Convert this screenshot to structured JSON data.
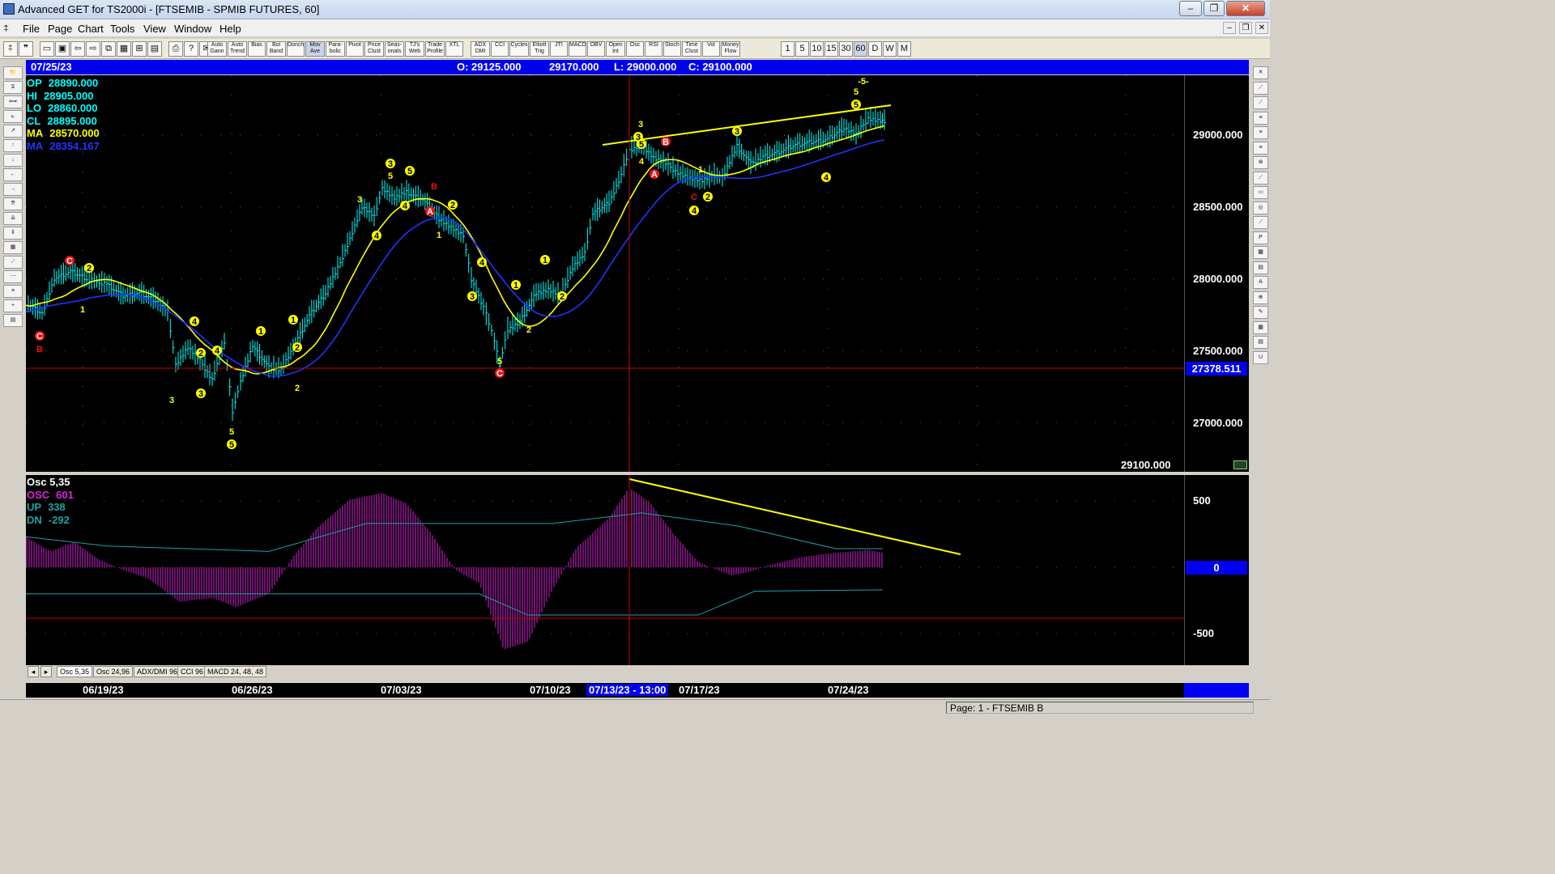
{
  "window": {
    "title": "Advanced GET for TS2000i - [FTSEMIB - SPMIB FUTURES, 60]",
    "min": "‒",
    "max": "❐",
    "close": "✕"
  },
  "menu": [
    "File",
    "Page",
    "Chart",
    "Tools",
    "View",
    "Window",
    "Help"
  ],
  "toolbar": {
    "study_buttons": [
      "Auto Gann",
      "Auto Trend",
      "Bias",
      "Bol Band",
      "Donch",
      "Mov Ave",
      "Para-bolic",
      "Pivot",
      "Price Clust",
      "Seas-onals",
      "TJ's Web",
      "Trade Profile",
      "XTL",
      "ADX DMI",
      "CCI",
      "Cycles",
      "Elliott Trig",
      "JTI",
      "MACD",
      "OBV",
      "Open Int",
      "Osc",
      "RSI",
      "Stoch",
      "Time Clust",
      "Vol",
      "Money Flow"
    ],
    "intervals": [
      "1",
      "5",
      "10",
      "15",
      "30",
      "60",
      "D",
      "W",
      "M"
    ],
    "selected_interval": "60"
  },
  "header_bar": {
    "date": "07/25/23",
    "open": "O: 29125.000",
    "high": "29170.000",
    "low": "L: 29000.000",
    "close": "C: 29100.000"
  },
  "legend": [
    {
      "label": "OP",
      "value": "28890.000",
      "color": "#00ffff"
    },
    {
      "label": "HI",
      "value": "28905.000",
      "color": "#00ffff"
    },
    {
      "label": "LO",
      "value": "28860.000",
      "color": "#00ffff"
    },
    {
      "label": "CL",
      "value": "28895.000",
      "color": "#00ffff"
    },
    {
      "label": "MA",
      "value": "28570.000",
      "color": "#ffff00"
    },
    {
      "label": "MA",
      "value": "28354.167",
      "color": "#2233ff"
    }
  ],
  "price_axis": [
    "29000.000",
    "28500.000",
    "28000.000",
    "27500.000",
    "27000.000"
  ],
  "cursor_price": "27378.511",
  "last_price_label": "29100.000",
  "osc_legend": [
    {
      "label": "Osc 5,35",
      "value": "",
      "color": "#ffffff"
    },
    {
      "label": "OSC",
      "value": "601",
      "color": "#dd22dd"
    },
    {
      "label": "UP",
      "value": "338",
      "color": "#1fa0a0"
    },
    {
      "label": "DN",
      "value": "-292",
      "color": "#1fa0a0"
    }
  ],
  "osc_axis": [
    "500",
    "0",
    "-500"
  ],
  "tabs": [
    "Osc 5,35",
    "Osc 24,96",
    "ADX/DMI 96",
    "CCI 96",
    "MACD 24, 48, 48"
  ],
  "dates": [
    "06/19/23",
    "06/26/23",
    "07/03/23",
    "07/10/23",
    "07/13/23 - 13:00",
    "07/17/23",
    "07/24/23"
  ],
  "status": "Page: 1 - FTSEMIB B",
  "wave_labels": [
    {
      "t": "C",
      "c": "red"
    },
    {
      "t": "B",
      "c": "red"
    },
    {
      "t": "C",
      "c": "red"
    },
    {
      "t": "2",
      "c": "yellow"
    },
    {
      "t": "1",
      "c": "yellow"
    },
    {
      "t": "4",
      "c": "yellow"
    },
    {
      "t": "2",
      "c": "yellow"
    },
    {
      "t": "3",
      "c": "yellow"
    },
    {
      "t": "3",
      "c": "yellow"
    },
    {
      "t": "4",
      "c": "yellow"
    },
    {
      "t": "5",
      "c": "yellow"
    },
    {
      "t": "5",
      "c": "yellow"
    },
    {
      "t": "1",
      "c": "yellow"
    },
    {
      "t": "2",
      "c": "yellow"
    },
    {
      "t": "1",
      "c": "yellow"
    },
    {
      "t": "2",
      "c": "yellow"
    },
    {
      "t": "3",
      "c": "yellow"
    },
    {
      "t": "4",
      "c": "yellow"
    },
    {
      "t": "3",
      "c": "yellow"
    },
    {
      "t": "5",
      "c": "yellow"
    },
    {
      "t": "5",
      "c": "yellow"
    },
    {
      "t": "4",
      "c": "yellow"
    },
    {
      "t": "B",
      "c": "red"
    },
    {
      "t": "A",
      "c": "red"
    },
    {
      "t": "2",
      "c": "yellow"
    },
    {
      "t": "1",
      "c": "yellow"
    },
    {
      "t": "4",
      "c": "yellow"
    },
    {
      "t": "3",
      "c": "yellow"
    },
    {
      "t": "5",
      "c": "yellow"
    },
    {
      "t": "C",
      "c": "red"
    },
    {
      "t": "1",
      "c": "yellow"
    },
    {
      "t": "2",
      "c": "yellow"
    },
    {
      "t": "2",
      "c": "yellow"
    },
    {
      "t": "1",
      "c": "yellow"
    },
    {
      "t": "3",
      "c": "yellow"
    },
    {
      "t": "3",
      "c": "yellow"
    },
    {
      "t": "5",
      "c": "yellow"
    },
    {
      "t": "4",
      "c": "yellow"
    },
    {
      "t": "B",
      "c": "red"
    },
    {
      "t": "A",
      "c": "red"
    },
    {
      "t": "C",
      "c": "red"
    },
    {
      "t": "2",
      "c": "yellow"
    },
    {
      "t": "4",
      "c": "yellow"
    },
    {
      "t": "1",
      "c": "yellow"
    },
    {
      "t": "3",
      "c": "yellow"
    },
    {
      "t": "4",
      "c": "yellow"
    },
    {
      "t": "5",
      "c": "yellow"
    },
    {
      "t": "5",
      "c": "yellow"
    },
    {
      "t": "-5-",
      "c": "yellow"
    }
  ]
}
